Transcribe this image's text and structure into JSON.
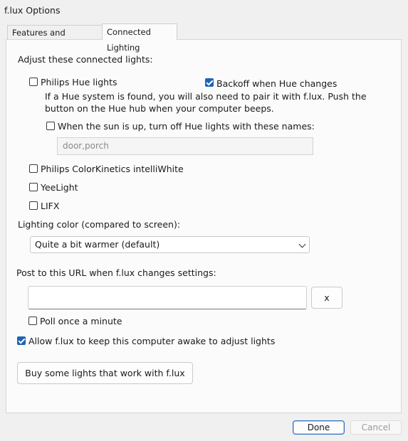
{
  "window": {
    "title": "f.lux Options"
  },
  "tabs": [
    {
      "label": "Features and Notifications",
      "active": false
    },
    {
      "label": "Connected Lighting",
      "active": true
    }
  ],
  "section": {
    "heading": "Adjust these connected lights:"
  },
  "hue": {
    "label": "Philips Hue lights",
    "checked": false,
    "backoff_label": "Backoff when Hue changes",
    "backoff_checked": true,
    "note_line1": "If a Hue system is found, you will also need to pair it with f.lux. Push the",
    "note_line2": "button on the Hue hub when your computer beeps.",
    "sun_label": "When the sun is up, turn off Hue lights with these names:",
    "sun_checked": false,
    "names_value": "door,porch"
  },
  "colorkinetics": {
    "label": "Philips ColorKinetics intelliWhite",
    "checked": false
  },
  "yeelight": {
    "label": "YeeLight",
    "checked": false
  },
  "lifx": {
    "label": "LIFX",
    "checked": false
  },
  "lighting_color": {
    "label": "Lighting color (compared to screen):",
    "selected": "Quite a bit warmer (default)"
  },
  "post_url": {
    "label": "Post to this URL when f.lux changes settings:",
    "value": "",
    "clear_label": "x",
    "poll_label": "Poll once a minute",
    "poll_checked": false
  },
  "awake": {
    "label": "Allow f.lux to keep this computer awake to adjust lights",
    "checked": true
  },
  "buy_button": {
    "label": "Buy some lights that work with f.lux"
  },
  "footer": {
    "done_label": "Done",
    "cancel_label": "Cancel"
  },
  "colors": {
    "accent": "#1f63b5",
    "panel": "#fbfbfb",
    "window": "#f0f0f0"
  }
}
